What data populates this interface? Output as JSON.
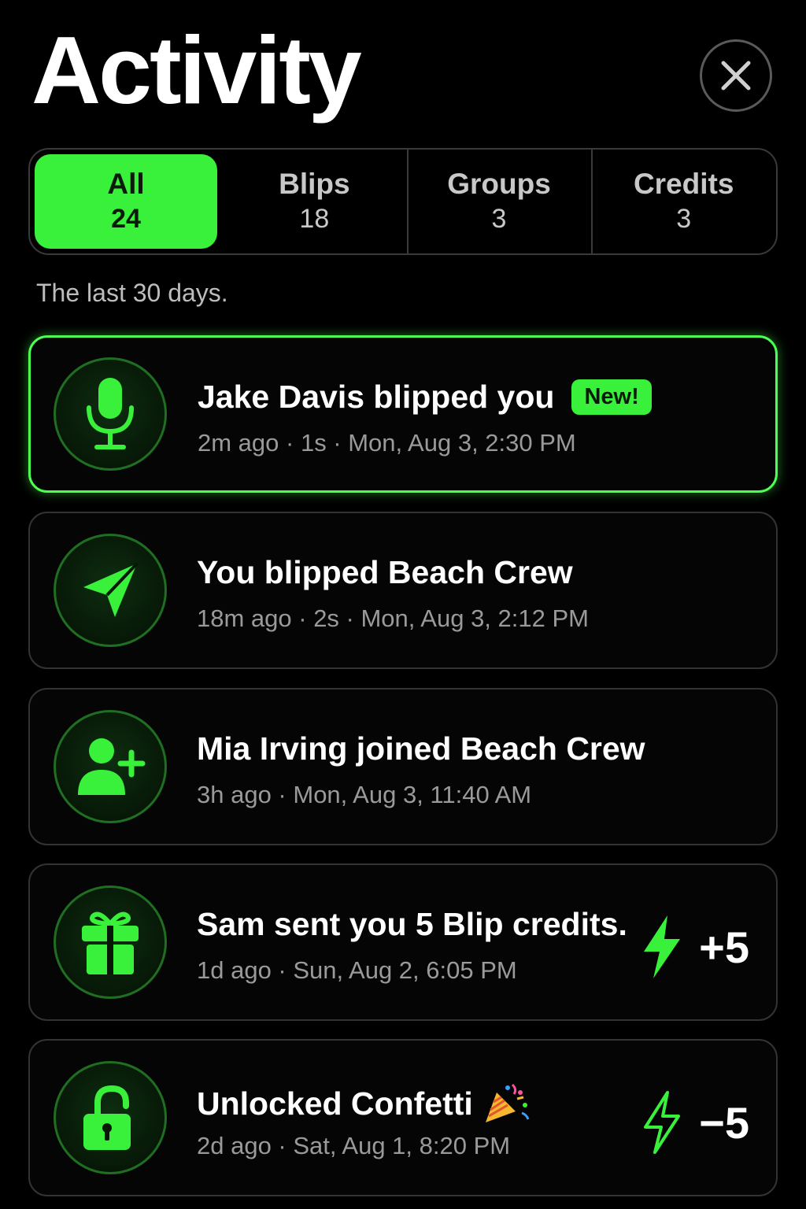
{
  "header": {
    "title": "Activity"
  },
  "tabs": [
    {
      "label": "All",
      "count": "24"
    },
    {
      "label": "Blips",
      "count": "18"
    },
    {
      "label": "Groups",
      "count": "3"
    },
    {
      "label": "Credits",
      "count": "3"
    }
  ],
  "subtitle": "The last 30 days.",
  "activities": [
    {
      "icon": "microphone-icon",
      "title": "Jake Davis blipped you",
      "badge": "New!",
      "meta": "2m ago · 1s · Mon, Aug 3, 2:30 PM"
    },
    {
      "icon": "paper-plane-icon",
      "title": "You blipped Beach Crew",
      "meta": "18m ago · 2s · Mon, Aug 3, 2:12 PM"
    },
    {
      "icon": "user-plus-icon",
      "title": "Mia Irving joined Beach Crew",
      "meta": "3h ago · Mon, Aug 3, 11:40 AM"
    },
    {
      "icon": "gift-icon",
      "title": "Sam sent you 5 Blip credits.",
      "meta": "1d ago · Sun, Aug 2, 6:05 PM",
      "credit": "+5",
      "credit_icon": "lightning-filled-icon"
    },
    {
      "icon": "unlocked-padlock-icon",
      "title": "Unlocked Confetti",
      "title_emoji": "party-popper-icon",
      "meta": "2d ago · Sat, Aug 1, 8:20 PM",
      "credit": "−5",
      "credit_icon": "lightning-outline-icon"
    }
  ],
  "colors": {
    "accent": "#39f03b",
    "background": "#000000",
    "border": "#333333",
    "meta_text": "#9a9a9a"
  }
}
